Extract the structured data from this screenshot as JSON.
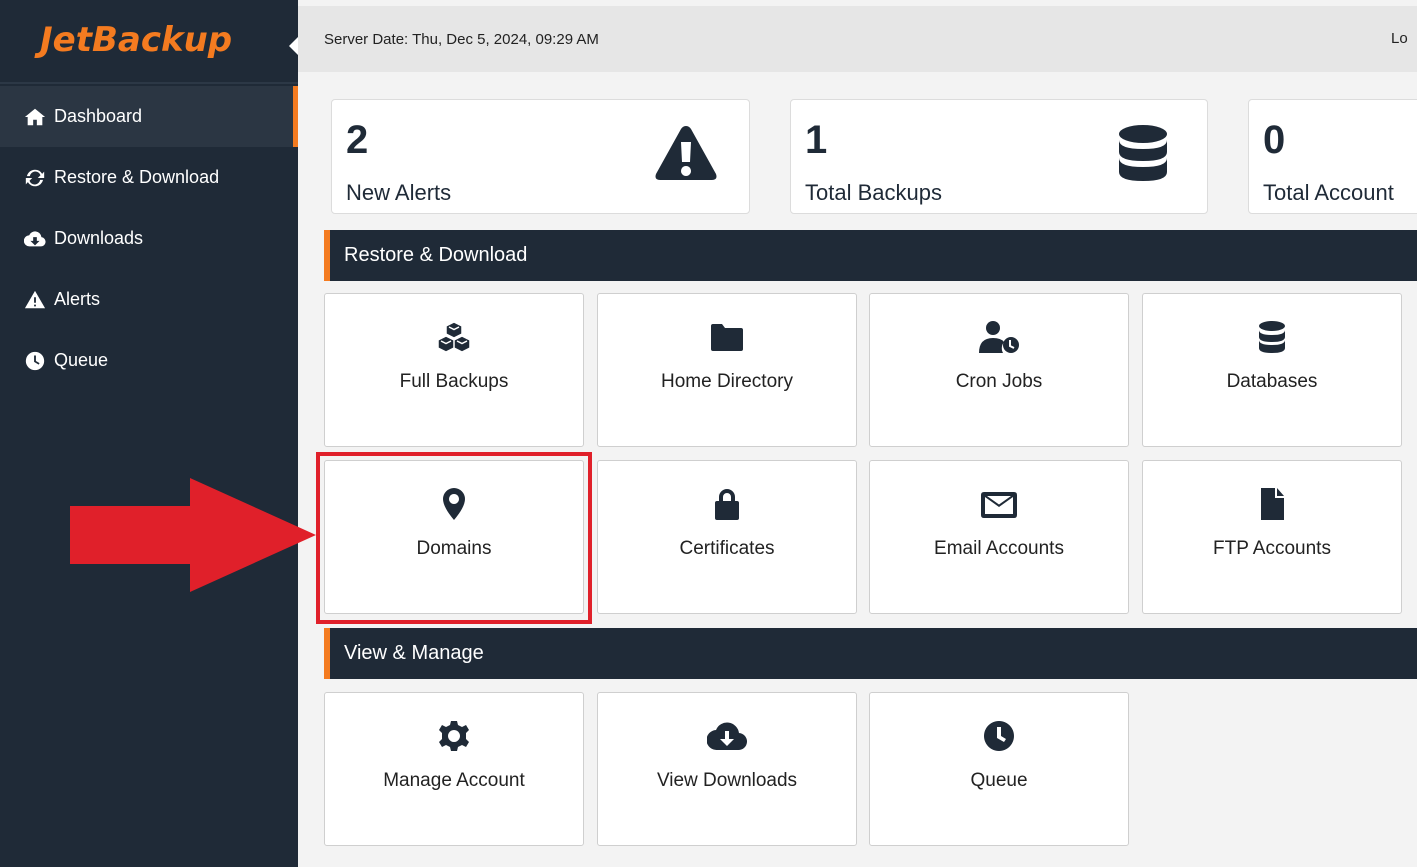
{
  "app": {
    "logo_text": "JetBackup",
    "accent_color": "#f47b20",
    "sidebar_color": "#1f2a37"
  },
  "topbar": {
    "server_date": "Server Date: Thu, Dec 5, 2024, 09:29 AM",
    "logout_label": "Lo"
  },
  "sidebar": {
    "items": [
      {
        "label": "Dashboard",
        "icon": "home-icon",
        "active": true
      },
      {
        "label": "Restore & Download",
        "icon": "sync-icon"
      },
      {
        "label": "Downloads",
        "icon": "cloud-download-icon"
      },
      {
        "label": "Alerts",
        "icon": "warning-icon"
      },
      {
        "label": "Queue",
        "icon": "clock-icon"
      }
    ]
  },
  "stats": [
    {
      "value": "2",
      "label": "New Alerts",
      "icon": "warning-icon"
    },
    {
      "value": "1",
      "label": "Total Backups",
      "icon": "database-icon"
    },
    {
      "value": "0",
      "label": "Total Account",
      "icon": ""
    }
  ],
  "sections": {
    "restore": {
      "title": "Restore & Download",
      "tiles": [
        {
          "label": "Full Backups",
          "icon": "cubes-icon"
        },
        {
          "label": "Home Directory",
          "icon": "folder-icon"
        },
        {
          "label": "Cron Jobs",
          "icon": "user-clock-icon"
        },
        {
          "label": "Databases",
          "icon": "database-icon"
        },
        {
          "label": "Domains",
          "icon": "map-marker-icon",
          "highlighted": true
        },
        {
          "label": "Certificates",
          "icon": "lock-icon"
        },
        {
          "label": "Email Accounts",
          "icon": "envelope-icon"
        },
        {
          "label": "FTP Accounts",
          "icon": "file-icon"
        }
      ]
    },
    "manage": {
      "title": "View & Manage",
      "tiles": [
        {
          "label": "Manage Account",
          "icon": "gear-icon"
        },
        {
          "label": "View Downloads",
          "icon": "cloud-download-icon"
        },
        {
          "label": "Queue",
          "icon": "clock-icon"
        }
      ]
    }
  },
  "annotation": {
    "color": "#e0202a",
    "target": "Domains"
  }
}
